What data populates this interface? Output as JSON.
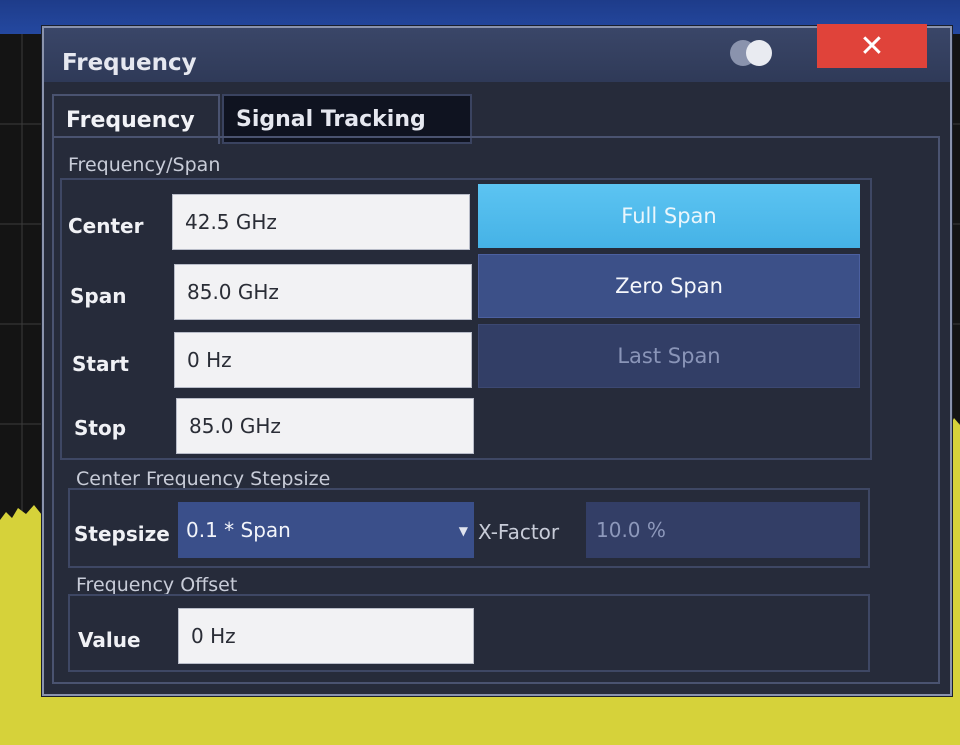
{
  "dialog": {
    "title": "Frequency",
    "close_icon": "close-icon",
    "toggle_icon": "display-toggle-icon"
  },
  "tabs": [
    {
      "label": "Frequency",
      "active": true
    },
    {
      "label": "Signal Tracking",
      "active": false
    }
  ],
  "frequency_span": {
    "group_label": "Frequency/Span",
    "fields": [
      {
        "label": "Center",
        "value": "42.5 GHz"
      },
      {
        "label": "Span",
        "value": "85.0 GHz"
      },
      {
        "label": "Start",
        "value": "0 Hz"
      },
      {
        "label": "Stop",
        "value": "85.0 GHz"
      }
    ],
    "buttons": {
      "full_span": "Full Span",
      "zero_span": "Zero Span",
      "last_span": "Last Span"
    }
  },
  "stepsize": {
    "group_label": "Center Frequency Stepsize",
    "label": "Stepsize",
    "selected": "0.1 * Span",
    "xfactor_label": "X-Factor",
    "xfactor_value": "10.0 %"
  },
  "offset": {
    "group_label": "Frequency Offset",
    "label": "Value",
    "value": "0 Hz"
  },
  "colors": {
    "accent": "#45b2e6",
    "close": "#e0433a",
    "trace": "#d6d23a"
  }
}
